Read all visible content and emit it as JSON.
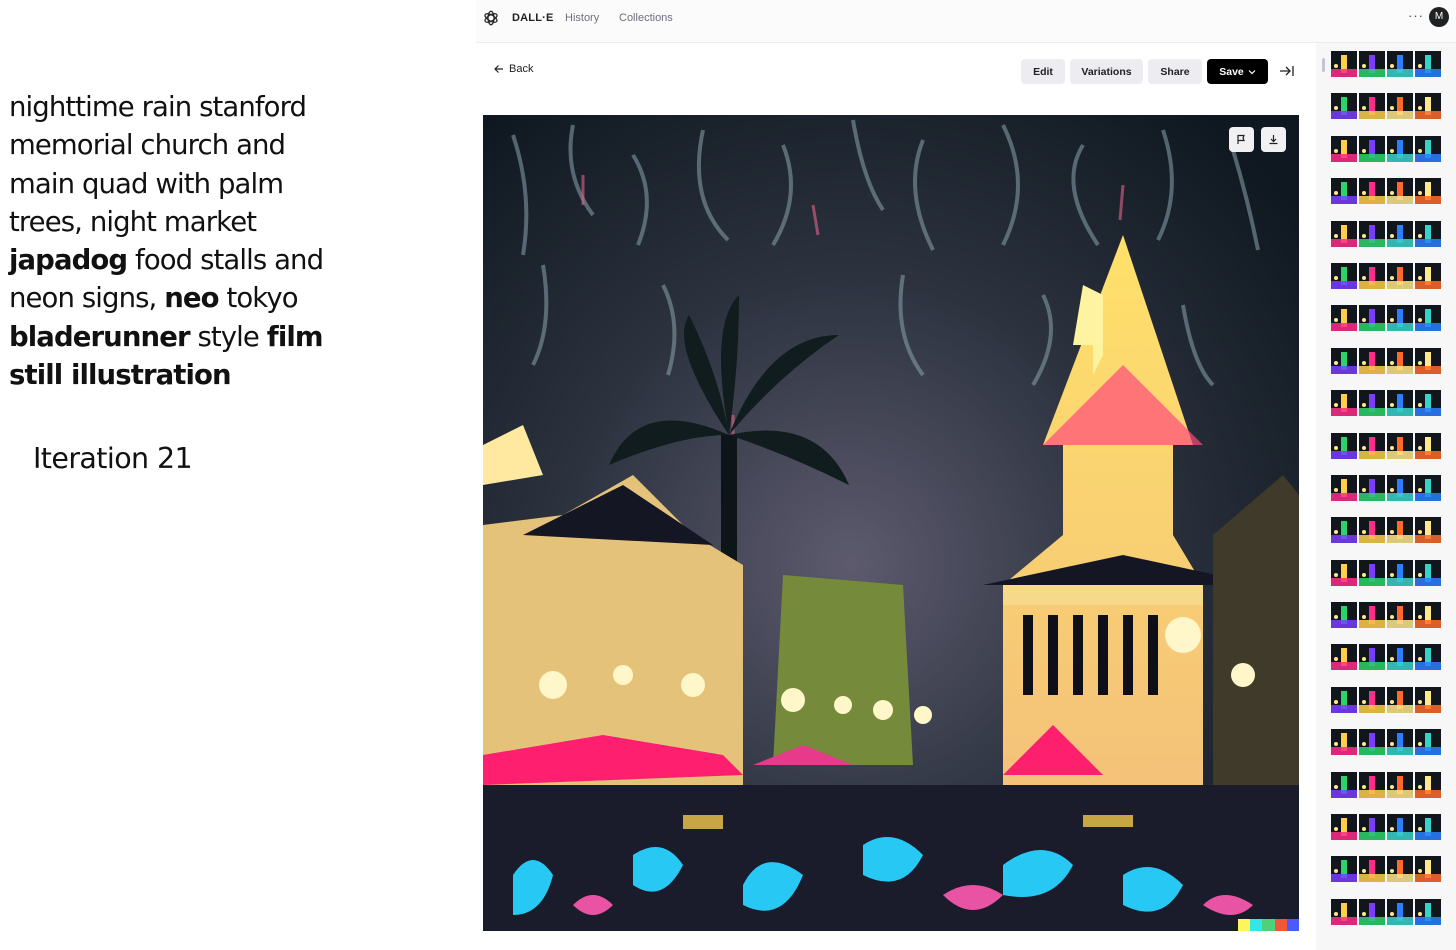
{
  "caption": {
    "segments": [
      {
        "text": "nighttime rain stanford memorial church and main quad with palm trees, night market ",
        "bold": false
      },
      {
        "text": "japadog",
        "bold": true
      },
      {
        "text": " food stalls and neon signs, ",
        "bold": false
      },
      {
        "text": "neo",
        "bold": true
      },
      {
        "text": " tokyo ",
        "bold": false
      },
      {
        "text": "bladerunner",
        "bold": true
      },
      {
        "text": " style ",
        "bold": false
      },
      {
        "text": "film still illustration",
        "bold": true
      }
    ],
    "iteration": "Iteration 21"
  },
  "app": {
    "brand": "DALL·E",
    "nav": [
      "History",
      "Collections"
    ],
    "more_label": "···",
    "avatar_initial": "M"
  },
  "toolbar": {
    "back_label": "Back",
    "edit_label": "Edit",
    "variations_label": "Variations",
    "share_label": "Share",
    "save_label": "Save"
  },
  "image": {
    "signature_colors": [
      "#fdf55c",
      "#34e6e6",
      "#4fd17a",
      "#f15638",
      "#4b59ff"
    ]
  },
  "history": {
    "thumbnail_rows": 21,
    "thumbnails_per_row": 4,
    "palette": [
      "#2a7fff",
      "#ff2d8a",
      "#ffcf4a",
      "#37d3c9",
      "#ff6a2a",
      "#7a3dff",
      "#2bd36a",
      "#ffe98a"
    ]
  },
  "colors": {
    "accent_button": "#000000",
    "button_bg": "#ececf1"
  }
}
